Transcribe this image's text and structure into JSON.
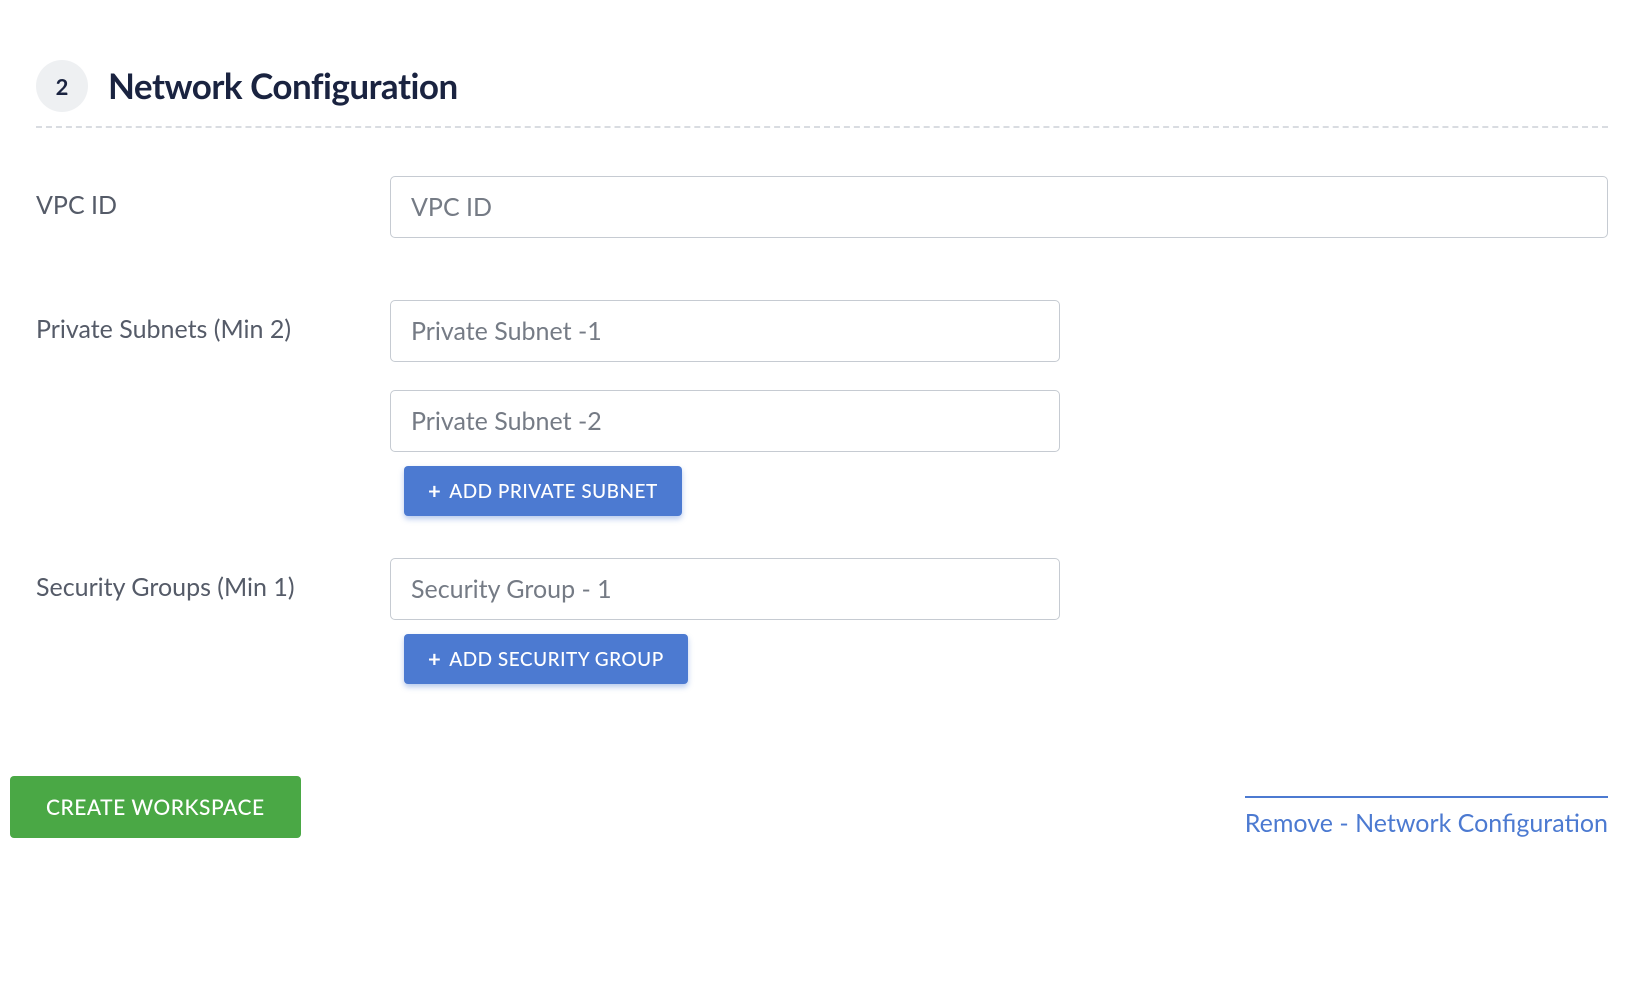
{
  "section": {
    "step_number": "2",
    "title": "Network Configuration"
  },
  "fields": {
    "vpc": {
      "label": "VPC ID",
      "placeholder": "VPC ID",
      "value": ""
    },
    "subnets": {
      "label": "Private Subnets (Min 2)",
      "input1_placeholder": "Private Subnet -1",
      "input1_value": "",
      "input2_placeholder": "Private Subnet -2",
      "input2_value": "",
      "add_button": "ADD PRIVATE SUBNET"
    },
    "security_groups": {
      "label": "Security Groups (Min 1)",
      "input1_placeholder": "Security Group - 1",
      "input1_value": "",
      "add_button": "ADD SECURITY GROUP"
    }
  },
  "footer": {
    "create_button": "CREATE WORKSPACE",
    "remove_link": "Remove - Network Configuration"
  }
}
